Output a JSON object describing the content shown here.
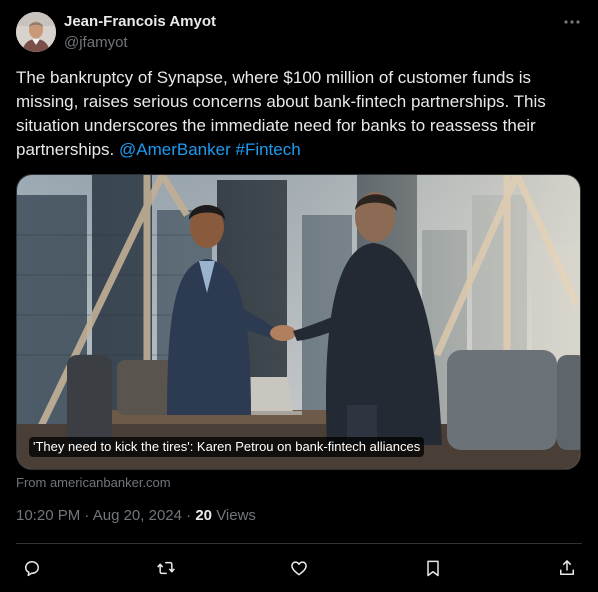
{
  "author": {
    "name": "Jean-Francois Amyot",
    "handle": "@jfamyot"
  },
  "tweet": {
    "text_before": "The bankruptcy of Synapse, where $100 million of customer funds is missing, raises serious concerns about bank-fintech partnerships. This situation underscores the immediate need for banks to reassess their partnerships. ",
    "mention": "@AmerBanker",
    "hashtag": "#Fintech"
  },
  "card": {
    "caption": "'They need to kick the tires': Karen Petrou on bank-fintech alliances",
    "source": "From americanbanker.com"
  },
  "meta": {
    "time": "10:20 PM",
    "separator": "·",
    "date": "Aug 20, 2024",
    "views_count": "20",
    "views_label": "Views"
  },
  "icons": {
    "more": "more-dots-icon",
    "reply": "reply-bubble-icon",
    "retweet": "retweet-icon",
    "like": "heart-icon",
    "bookmark": "bookmark-icon",
    "share": "share-upload-icon"
  },
  "colors": {
    "background": "#000000",
    "text_primary": "#e7e9ea",
    "text_secondary": "#71767b",
    "link": "#1d9bf0",
    "border": "#2f3336"
  }
}
